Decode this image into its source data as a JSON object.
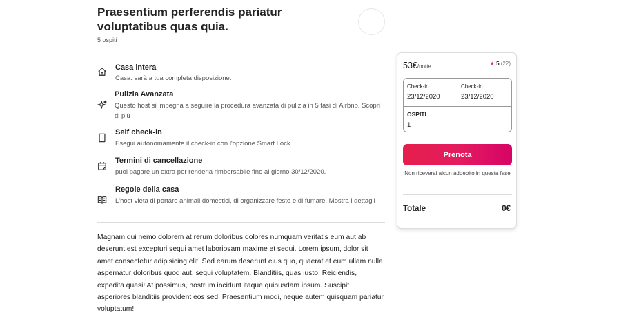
{
  "listing": {
    "title": "Praesentium perferendis pariatur voluptatibus quas quia.",
    "guests": "5 ospiti"
  },
  "features": [
    {
      "icon": "home-icon",
      "title": "Casa intera",
      "description": "Casa: sarà a tua completa disposizione."
    },
    {
      "icon": "sparkle-icon",
      "title": "Pulizia Avanzata",
      "description": "Questo host si impegna a seguire la procedura avanzata di pulizia in 5 fasi di Airbnb. Scopri di più"
    },
    {
      "icon": "door-icon",
      "title": "Self check-in",
      "description": "Esegui autonomamente il check-in con l'opzione Smart Lock."
    },
    {
      "icon": "calendar-icon",
      "title": "Termini di cancellazione",
      "description": "puoi pagare un extra per renderla rimborsabile fino al giorno 30/12/2020."
    },
    {
      "icon": "book-icon",
      "title": "Regole della casa",
      "description": "L'host vieta di portare animali domestici, di organizzare feste e di fumare. Mostra i dettagli"
    }
  ],
  "description": "Magnam qui nemo dolorem at rerum doloribus dolores numquam veritatis eum aut ab deserunt est excepturi sequi amet laboriosam maxime et sequi. Lorem ipsum, dolor sit amet consectetur adipisicing elit. Sed earum deserunt eius quo, quaerat et eum ullam nulla aspernatur doloribus quod aut, sequi voluptatem. Blanditiis, quas iusto. Reiciendis, expedita quasi! At possimus, nostrum incidunt itaque quibusdam ipsum. Suscipit asperiores blanditiis provident eos sed. Praesentium modi, neque autem quisquam pariatur voluptatum!",
  "booking": {
    "price": "53€",
    "price_unit": "/notte",
    "rating_star": "★",
    "rating": "5",
    "reviews": "(22)",
    "checkin_label": "Check-in",
    "checkin_value": "23/12/2020",
    "checkout_label": "Check-in",
    "checkout_value": "23/12/2020",
    "guests_label": "OSPITI",
    "guests_value": "1",
    "reserve_label": "Prenota",
    "notice": "Non riceverai alcun addebito in questa fase",
    "total_label": "Totale",
    "total_value": "0€"
  },
  "colors": {
    "accent": "#e31c5f",
    "star": "#e8364f"
  }
}
